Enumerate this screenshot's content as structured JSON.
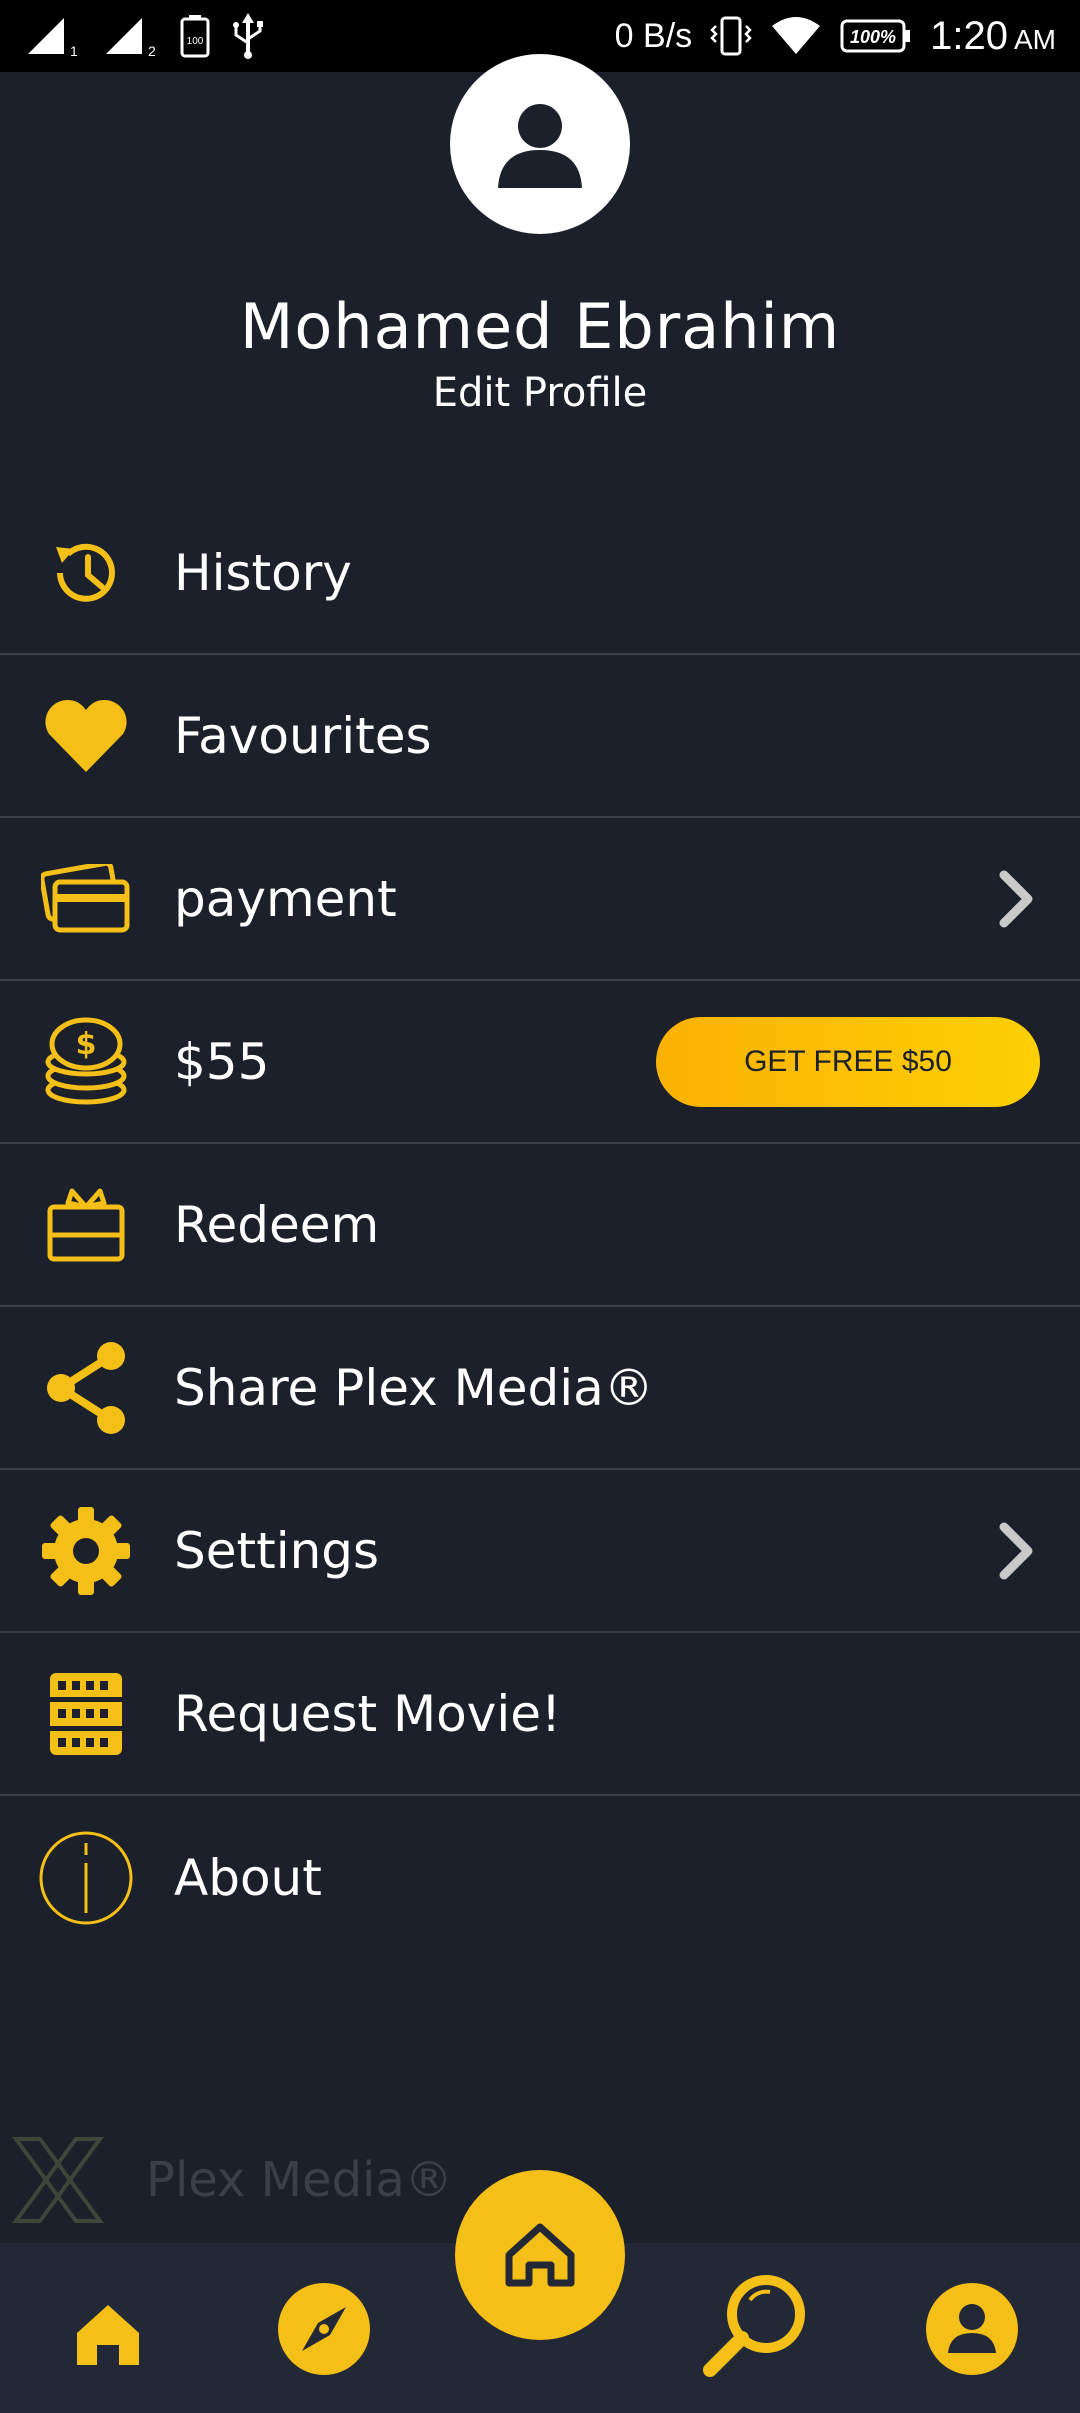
{
  "status_bar": {
    "network_speed": "0 B/s",
    "battery_percent": "100%",
    "battery_small": "100",
    "sim1": "1",
    "sim2": "2",
    "time": "1:20",
    "ampm": "AM"
  },
  "profile": {
    "name": "Mohamed Ebrahim",
    "edit_label": "Edit Profile"
  },
  "menu": {
    "items": [
      {
        "label": "History",
        "icon": "history-icon"
      },
      {
        "label": "Favourites",
        "icon": "heart-icon"
      },
      {
        "label": "payment",
        "icon": "card-icon"
      },
      {
        "label": "$55",
        "icon": "coins-icon"
      },
      {
        "label": "Redeem",
        "icon": "gift-icon"
      },
      {
        "label": "Share Plex Media®",
        "icon": "share-icon"
      },
      {
        "label": "Settings",
        "icon": "gear-icon"
      },
      {
        "label": "Request Movie!",
        "icon": "film-icon"
      },
      {
        "label": "About",
        "icon": "info-icon"
      }
    ],
    "free_button_label": "GET FREE $50"
  },
  "brand": {
    "name": "Plex Media®"
  },
  "colors": {
    "accent": "#f4bf17",
    "background": "#1b202a",
    "divider": "#3a3f49",
    "nav_background": "#222835"
  }
}
